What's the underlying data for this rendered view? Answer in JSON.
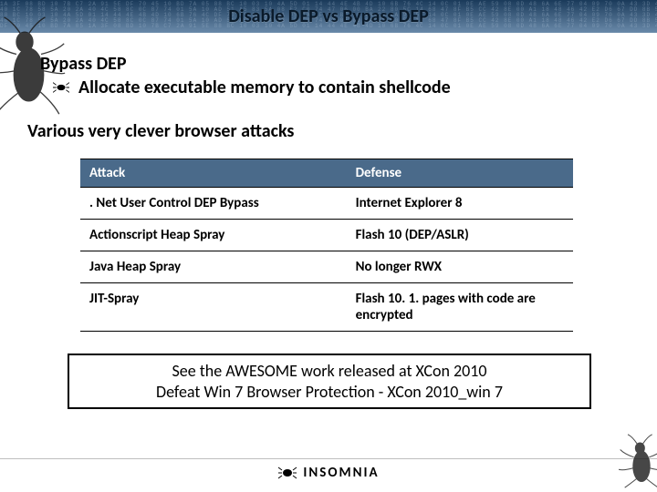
{
  "title": "Disable DEP vs Bypass DEP",
  "section": {
    "heading": "Bypass DEP",
    "bullet": "Allocate executable memory to contain shellcode"
  },
  "subheading": "Various very clever browser attacks",
  "table": {
    "headers": {
      "attack": "Attack",
      "defense": "Defense"
    },
    "rows": [
      {
        "attack": ". Net User Control DEP Bypass",
        "defense": "Internet Explorer 8"
      },
      {
        "attack": "Actionscript Heap Spray",
        "defense": "Flash 10 (DEP/ASLR)"
      },
      {
        "attack": "Java Heap Spray",
        "defense": "No longer RWX"
      },
      {
        "attack": "JIT-Spray",
        "defense": "Flash 10. 1. pages with code are encrypted"
      }
    ]
  },
  "callout": {
    "line1": "See the AWESOME work released at XCon 2010",
    "line2": "Defeat Win 7 Browser Protection - XCon 2010_win 7"
  },
  "footer": {
    "brand": "INSOMNIA"
  },
  "hex": "1A 3F 08 BD 10 7B C7 2A 91 5E DF 70 45 10 BD 7A 05 88 BC 10 03 10 4A 5D 01 14 44 4E 4B 4D 10 6B 76 4C 14 0C 01 0E AE 59 08 0D 48 6A 6E 77 04 09 70 0A 43 3D 48 51 10 20 5C 91 7F 0A 8E 07 74 BE 9D 7F 5B 5C 06 85 92 42 87 58 3D CE 06 DA 52 0D 8E 35 FB 58 59 21 3D 14 45 10 08 F4 4A B1 EB 51 5F 0A 20 4A DD 70 84 11 73 08\n40 1C 78 58 5A 20 2A 40 4C 58 8C 0C 87 74 01 5A 10 AD 51 A5 83 5A 08 E2 C0 74 47 06 00 BA 22 80 5C 14 68 47 8F B5 CC 42 8E 00 A1 18 48 46 42 E2 D6 67 DD 8B 58 4B 7E 0B B4 F8 58 48 08 F8 50 08 08 58 5F 9E BA 4B 10 D4 04 D8 74 74 11 7A 26 AA 86 E5 56 87 18 00 0A 71 5C 10 5F 54 B5 5C 35 4A 4B 00 55 10 64 1A 50 33\n88 BC 10 03 10 4A 5D 01 14 44 4E 4B 4D 10 6B 76 4C DF 70 45 10 BD 7A 05 1A 3F 08 BD 10 7B C7 2A 91 5E 14 0C 01 0E AE 59 08 0D 48 6A 6E 77 04 09 70 0A 43 3D 48 51 10 20 5C 91 7F 0A 8E 07 74 BE 9D 7F 5B 5C 06 85 92 42 87 58 3D CE 06 DA 52 0D 8E 35 FB 58 59 21 3D 14 45 10 08 F4 4A B1 EB 51 5F 0A 20 4A DD 70 84 11 73 08\n40 1C 78 58 5A 20 2A 40 4C 58 8C 0C 87 74 01 5A 10 AD 51 A5 83 5A 08 E2 C0 74 47 06 00 BA 22 80 5C 14 68 47 8F B5 CC 42 8E 00 A1 18 48 46 42 E2 D6 67 DD 8B 58 4B 7E 0B B4 F8 58 48 08 F8 50 08 08 58 5F 9E BA 4B 10 D4 04 D8 74 74 11 7A 26 AA 86 E5 56 87 18 00 0A 71 5C 10 5F 54 B5 5C 35 4A 4B 00 55 10 64 1A 50 33\nDF 70 45 10 BD 7A 05 1A 3F 08 BD 10 7B C7 2A 91 5E 88 BC 10 03 10 4A 5D 01 14 44 4E 4B 4D 10 6B 76 4C 14 0C 01 0E AE 59 08 0D 48 6A 6E 77 04 09 70 0A 43 3D 48 51 10 20 5C 91 7F 0A 8E 07 74 BE 9D 7F 5B 5C 06 85 92 42 87 58 3D CE 06 DA 52 0D 8E 35 FB 58 59 21 3D 14 45 10 08 F4 4A B1 EB 51 5F 0A 20 4A DD 70 84 11 73"
}
